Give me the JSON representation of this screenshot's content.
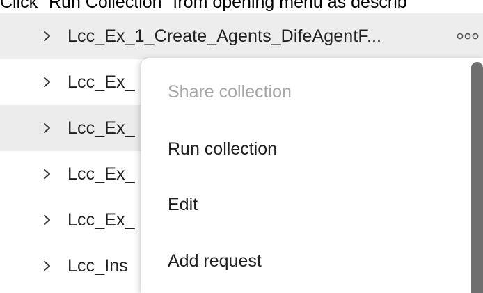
{
  "caption": "Click \"Run Collection\" from opening menu as describ",
  "sidebar": {
    "items": [
      {
        "label": "Lcc_Ex_1_Create_Agents_DifeAgentF...",
        "state": "hovered"
      },
      {
        "label": "Lcc_Ex_",
        "state": "normal"
      },
      {
        "label": "Lcc_Ex_",
        "state": "selected"
      },
      {
        "label": "Lcc_Ex_",
        "state": "normal"
      },
      {
        "label": "Lcc_Ex_",
        "state": "normal"
      },
      {
        "label": "Lcc_Ins",
        "state": "normal"
      }
    ],
    "row_icon": "chevron-right-icon",
    "more_icon": "more-options-icon"
  },
  "context_menu": {
    "items": [
      {
        "label": "Share collection",
        "enabled": false
      },
      {
        "label": "Run collection",
        "enabled": true
      },
      {
        "label": "Edit",
        "enabled": true
      },
      {
        "label": "Add request",
        "enabled": true
      }
    ]
  },
  "colors": {
    "row_hover": "#ededed",
    "text": "#212121",
    "disabled_text": "#a6a6a6",
    "scrollbar": "#6f6f6f"
  }
}
